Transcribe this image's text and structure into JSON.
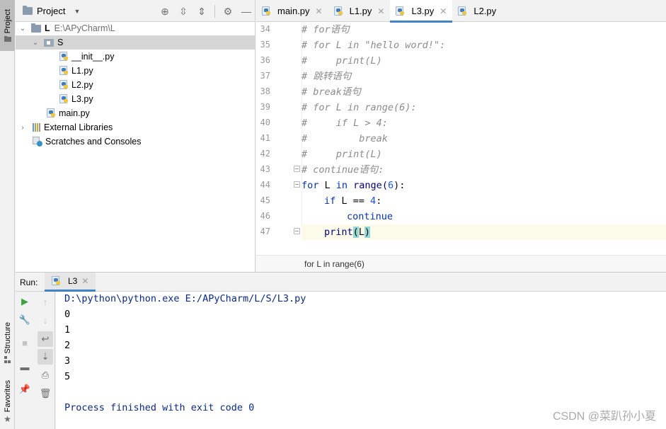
{
  "sidebar": {
    "project_tab": "Project",
    "structure_tab": "Structure",
    "favorites_tab": "Favorites"
  },
  "project": {
    "title": "Project",
    "tree": {
      "root_name": "L",
      "root_path": "E:\\APyCharm\\L",
      "folder_s": "S",
      "files_s": [
        "__init__.py",
        "L1.py",
        "L2.py",
        "L3.py"
      ],
      "main_file": "main.py",
      "external_libraries": "External Libraries",
      "scratches": "Scratches and Consoles"
    }
  },
  "editor": {
    "tabs": [
      {
        "label": "main.py",
        "active": false
      },
      {
        "label": "L1.py",
        "active": false
      },
      {
        "label": "L3.py",
        "active": true
      },
      {
        "label": "L2.py",
        "active": false
      }
    ],
    "line_numbers": [
      "34",
      "35",
      "36",
      "37",
      "38",
      "39",
      "40",
      "41",
      "42",
      "43",
      "44",
      "45",
      "46",
      "47"
    ],
    "code": {
      "l34": "# for语句",
      "l35": "# for L in \"hello word!\":",
      "l36": "#     print(L)",
      "l37": "# 跳转语句",
      "l38": "# break语句",
      "l39": "# for L in range(6):",
      "l40": "#     if L > 4:",
      "l41": "#         break",
      "l42": "#     print(L)",
      "l43": "# continue语句:",
      "l44_kw": "for",
      "l44_var": " L ",
      "l44_in": "in",
      "l44_fn": " range(",
      "l44_num": "6",
      "l44_end": "):",
      "l45_kw": "if",
      "l45_mid": " L == ",
      "l45_num": "4",
      "l45_end": ":",
      "l46_kw": "continue",
      "l47_fn": "print",
      "l47_open": "(",
      "l47_arg": "L",
      "l47_close": ")"
    },
    "breadcrumb": "for L in range(6)"
  },
  "run": {
    "label": "Run:",
    "tab_label": "L3",
    "command": "D:\\python\\python.exe E:/APyCharm/L/S/L3.py",
    "output": [
      "0",
      "1",
      "2",
      "3",
      "5"
    ],
    "exit_message": "Process finished with exit code 0"
  },
  "watermark": "CSDN @菜趴孙小夏",
  "colors": {
    "keyword": "#0033b3",
    "number": "#1750eb",
    "comment": "#8c8c8c",
    "accent_tab": "#4083c9",
    "console_text": "#0a2a8c"
  }
}
